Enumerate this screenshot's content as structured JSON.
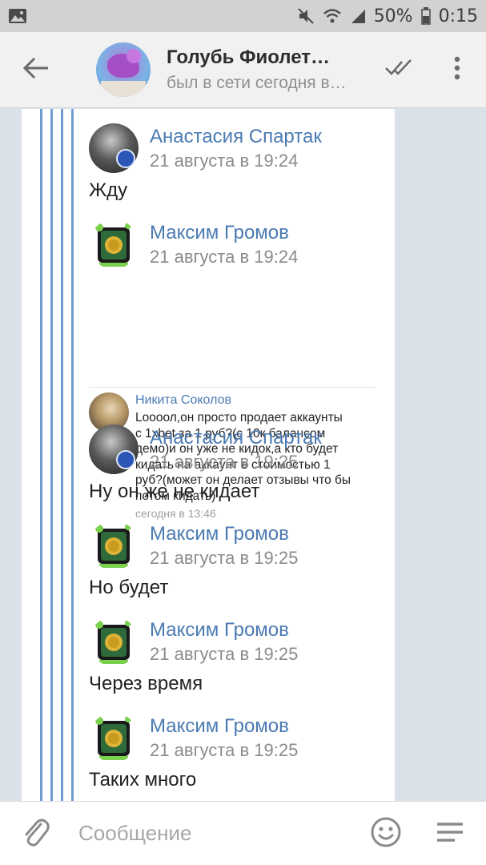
{
  "status_bar": {
    "battery": "50%",
    "time": "0:15",
    "icons": [
      "image-icon",
      "mute-icon",
      "wifi-icon",
      "signal-icon",
      "battery-icon"
    ]
  },
  "header": {
    "title": "Голубь Фиолет…",
    "subtitle": "был в сети сегодня в…",
    "icons": [
      "back-arrow-icon",
      "double-check-icon",
      "more-vert-icon"
    ]
  },
  "messages": [
    {
      "author": "Анастасия Спартак",
      "time": "21 августа в 19:24",
      "text": "Жду"
    },
    {
      "author": "Максим Громов",
      "time": "21 августа в 19:24",
      "text": ""
    },
    {
      "author": "Анастасия Спартак",
      "time": "21 августа в 19:25",
      "text": "Ну он же не кидает"
    },
    {
      "author": "Максим Громов",
      "time": "21 августа в 19:25",
      "text": "Но будет"
    },
    {
      "author": "Максим Громов",
      "time": "21 августа в 19:25",
      "text": "Через время"
    },
    {
      "author": "Максим Громов",
      "time": "21 августа в 19:25",
      "text": "Таких много"
    }
  ],
  "nested_forward": {
    "author": "Никита Соколов",
    "lines": [
      "Loooол,он просто продает аккаунты",
      "с 1xbet за 1 руб?(с 10к балансом",
      "демо)и он уже не кидок,а кто будет",
      "кидать на аккаунт в стоимостью 1",
      "руб?(может он делает отзывы что бы",
      "потом кидать)"
    ],
    "time": "сегодня в 13:46"
  },
  "input": {
    "placeholder": "Сообщение",
    "icons": [
      "paperclip-icon",
      "emoji-icon",
      "menu-icon"
    ]
  },
  "colors": {
    "accent": "#4a7ab2",
    "forward_line": "#6e9bd0",
    "background": "#dae1e8"
  }
}
